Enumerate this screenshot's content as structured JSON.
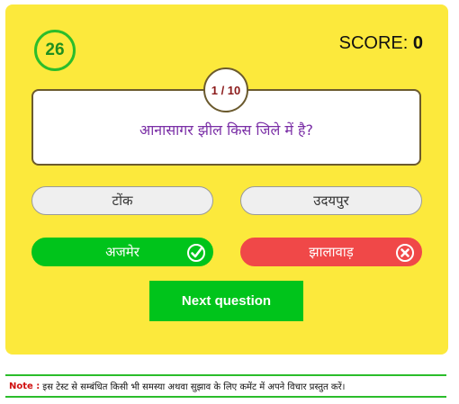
{
  "timer": {
    "seconds": "26"
  },
  "score": {
    "label": "SCORE: ",
    "value": "0"
  },
  "question": {
    "counter": "1 / 10",
    "text": "आनासागर झील किस जिले में है?"
  },
  "options": [
    {
      "label": "टोंक",
      "state": "neutral"
    },
    {
      "label": "उदयपुर",
      "state": "neutral"
    },
    {
      "label": "अजमेर",
      "state": "correct",
      "icon": "check-icon"
    },
    {
      "label": "झालावाड़",
      "state": "wrong",
      "icon": "cross-icon"
    }
  ],
  "next_button": {
    "label": "Next question"
  },
  "note": {
    "label": "Note :",
    "text": "इस टेस्ट से सम्बंधित किसी भी समस्या अथवा सुझाव के लिए कमेंट में अपने विचार प्रस्तुत करें।"
  },
  "colors": {
    "card_background": "#fce93c",
    "correct": "#00c41b",
    "wrong": "#f04848",
    "question_text": "#7a2ea6",
    "counter_text": "#8b1a1a"
  }
}
